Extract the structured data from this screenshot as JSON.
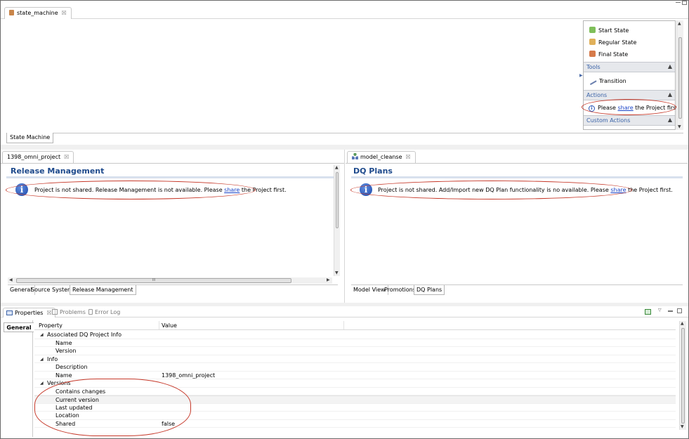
{
  "editor": {
    "tab_label": "state_machine",
    "bottom_tab": "State Machine"
  },
  "palette": {
    "items": [
      {
        "label": "Start State"
      },
      {
        "label": "Regular State"
      },
      {
        "label": "Final State"
      }
    ],
    "tools": {
      "title": "Tools",
      "item": "Transition"
    },
    "actions": {
      "title": "Actions",
      "msg_pre": "Please",
      "link": "share",
      "msg_post": "the Project first."
    },
    "custom_actions": {
      "title": "Custom Actions"
    }
  },
  "left_editor": {
    "tab_label": "1398_omni_project",
    "section_title": "Release Management",
    "msg_pre": "Project is not shared. Release Management is not available. Please",
    "link": "share",
    "msg_post": "the Project first.",
    "tabs": [
      "General",
      "Source Systems",
      "Release Management"
    ],
    "scroll_mark": "III"
  },
  "right_editor": {
    "tab_label": "model_cleanse",
    "section_title": "DQ Plans",
    "msg_pre": "Project is not shared. Add/Import new DQ Plan functionality is no available. Please",
    "link": "share",
    "msg_post": "the Project first.",
    "tabs": [
      "Model View",
      "Promotions",
      "DQ Plans"
    ]
  },
  "properties_view": {
    "tabs": [
      "Properties",
      "Problems",
      "Error Log"
    ],
    "side_tab": "General",
    "columns": {
      "property": "Property",
      "value": "Value"
    },
    "rows": [
      {
        "label": "Associated DQ Project Info",
        "value": ""
      },
      {
        "label": "Name",
        "value": ""
      },
      {
        "label": "Version",
        "value": ""
      },
      {
        "label": "Info",
        "value": ""
      },
      {
        "label": "Description",
        "value": ""
      },
      {
        "label": "Name",
        "value": "1398_omni_project"
      },
      {
        "label": "Versions",
        "value": ""
      },
      {
        "label": "Contains changes",
        "value": ""
      },
      {
        "label": "Current version",
        "value": ""
      },
      {
        "label": "Last updated",
        "value": ""
      },
      {
        "label": "Location",
        "value": ""
      },
      {
        "label": "Shared",
        "value": "false"
      }
    ]
  }
}
